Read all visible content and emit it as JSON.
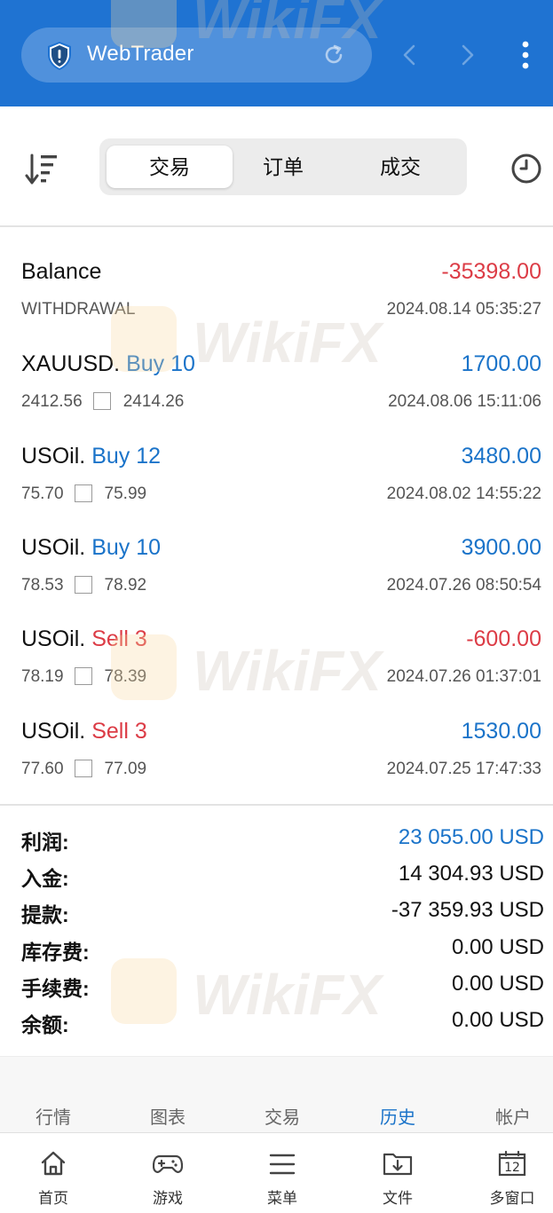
{
  "browser": {
    "url_text": "WebTrader",
    "colors": {
      "bar": "#1f73d2"
    }
  },
  "tabs": [
    {
      "label": "交易",
      "active": true
    },
    {
      "label": "订单",
      "active": false
    },
    {
      "label": "成交",
      "active": false
    }
  ],
  "balance_row": {
    "title": "Balance",
    "amount": "-35398.00",
    "type": "WITHDRAWAL",
    "time": "2024.08.14 05:35:27"
  },
  "deals": [
    {
      "symbol": "XAUUSD.",
      "side": "Buy 10",
      "side_color": "blue",
      "profit": "1700.00",
      "profit_color": "blue",
      "open": "2412.56",
      "close": "2414.26",
      "time": "2024.08.06 15:11:06"
    },
    {
      "symbol": "USOil.",
      "side": "Buy 12",
      "side_color": "blue",
      "profit": "3480.00",
      "profit_color": "blue",
      "open": "75.70",
      "close": "75.99",
      "time": "2024.08.02 14:55:22"
    },
    {
      "symbol": "USOil.",
      "side": "Buy 10",
      "side_color": "blue",
      "profit": "3900.00",
      "profit_color": "blue",
      "open": "78.53",
      "close": "78.92",
      "time": "2024.07.26 08:50:54"
    },
    {
      "symbol": "USOil.",
      "side": "Sell 3",
      "side_color": "red",
      "profit": "-600.00",
      "profit_color": "red",
      "open": "78.19",
      "close": "78.39",
      "time": "2024.07.26 01:37:01"
    },
    {
      "symbol": "USOil.",
      "side": "Sell 3",
      "side_color": "red",
      "profit": "1530.00",
      "profit_color": "blue",
      "open": "77.60",
      "close": "77.09",
      "time": "2024.07.25 17:47:33"
    }
  ],
  "summary": [
    {
      "label": "利润:",
      "value": "23 055.00 USD",
      "highlight": true
    },
    {
      "label": "入金:",
      "value": "14 304.93 USD",
      "highlight": false
    },
    {
      "label": "提款:",
      "value": "-37 359.93 USD",
      "highlight": false
    },
    {
      "label": "库存费:",
      "value": "0.00 USD",
      "highlight": false
    },
    {
      "label": "手续费:",
      "value": "0.00 USD",
      "highlight": false
    },
    {
      "label": "余额:",
      "value": "0.00 USD",
      "highlight": false
    }
  ],
  "app_nav": [
    {
      "label": "行情",
      "active": false
    },
    {
      "label": "图表",
      "active": false
    },
    {
      "label": "交易",
      "active": false
    },
    {
      "label": "历史",
      "active": true
    },
    {
      "label": "帐户",
      "active": false
    }
  ],
  "browser_nav": [
    {
      "label": "首页",
      "icon": "home-icon"
    },
    {
      "label": "游戏",
      "icon": "gamepad-icon"
    },
    {
      "label": "菜单",
      "icon": "menu-icon"
    },
    {
      "label": "文件",
      "icon": "folder-download-icon"
    },
    {
      "label": "多窗口",
      "icon": "windows-icon",
      "badge": "12"
    }
  ],
  "watermark": {
    "text": "WikiFX"
  },
  "colors": {
    "blue": "#1a73c9",
    "red": "#dc3c46",
    "active_tab_bg": "#ffffff",
    "segment_bg": "#ececec"
  }
}
